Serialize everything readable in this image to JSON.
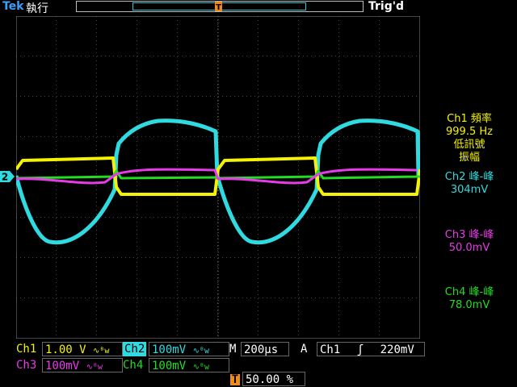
{
  "status": {
    "brand": "Tek",
    "run": "執行",
    "trigger": "Trig'd"
  },
  "markers": {
    "trigger_position": "T",
    "ch2_ground": "2"
  },
  "measurements": [
    {
      "lines": [
        "Ch1 頻率",
        "999.5 Hz",
        "低訊號",
        "振幅"
      ],
      "color": "#f5f300"
    },
    {
      "lines": [
        "Ch2 峰-峰",
        "304mV"
      ],
      "color": "#2fdbe0"
    },
    {
      "lines": [
        "Ch3 峰-峰",
        "50.0mV"
      ],
      "color": "#e83be8"
    },
    {
      "lines": [
        "Ch4 峰-峰",
        "78.0mV"
      ],
      "color": "#22dd22"
    }
  ],
  "channels": [
    {
      "label": "Ch1",
      "scale": "1.00 V",
      "color": "#f5f300"
    },
    {
      "label": "Ch2",
      "scale": "100mV",
      "color": "#2fdbe0"
    },
    {
      "label": "Ch3",
      "scale": "100mV",
      "color": "#e83be8"
    },
    {
      "label": "Ch4",
      "scale": "100mV",
      "color": "#22dd22"
    }
  ],
  "timebase": {
    "label": "M",
    "value": "200µs"
  },
  "trigger": {
    "mode": "A",
    "source": "Ch1",
    "level": "220mV",
    "slope_symbol": "ʃ"
  },
  "position": {
    "badge": "T",
    "value": "50.00 %"
  },
  "colors": {
    "ch1": "#f5f300",
    "ch2": "#2fdbe0",
    "ch3": "#e83be8",
    "ch4": "#22dd22",
    "grid": "#888888",
    "trigger_marker": "#f08a1f"
  }
}
